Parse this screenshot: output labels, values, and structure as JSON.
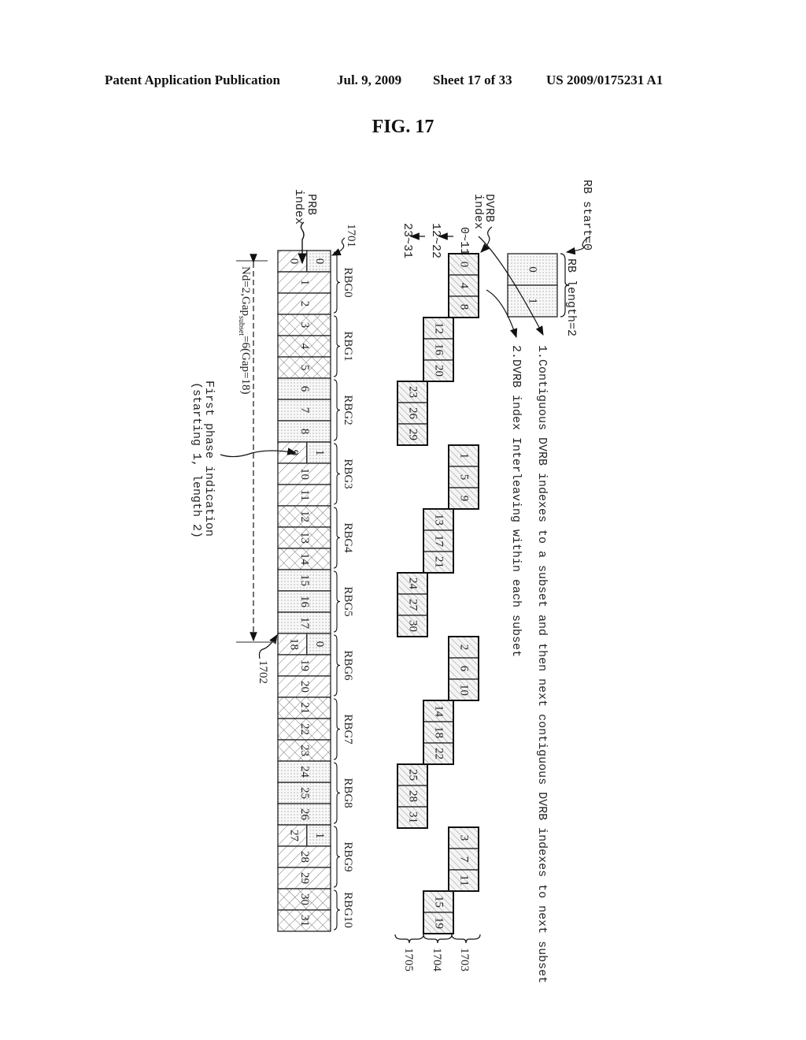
{
  "header": {
    "publication": "Patent Application Publication",
    "date": "Jul. 9, 2009",
    "sheet": "Sheet 17 of 33",
    "number": "US 2009/0175231 A1"
  },
  "figure_title": "FIG. 17",
  "labels": {
    "rb_start": "RB start=0",
    "rb_length": "RB length=2",
    "rb_cells": [
      "0",
      "1"
    ],
    "dvrb_index": [
      "DVRB",
      "index"
    ],
    "dvrb_ranges": [
      "0~11",
      "12~22",
      "23~31"
    ],
    "step1": "1.Contiguous DVRB indexes to a subset and then next contiguous DVRB indexes to next subset",
    "step2": "2.DVRB index Interleaving within each subset",
    "prb_index": [
      "PRB",
      "index"
    ],
    "ref_1701": "1701",
    "ref_1702": "1702",
    "gap_label_main": "Nd=2,Gap",
    "gap_label_sub": "subset",
    "gap_label_tail": "=6(Gap=18)",
    "first_phase": [
      "First phase indication",
      "(starting 1, length 2)"
    ],
    "subset_refs": [
      "1703",
      "1704",
      "1705"
    ]
  },
  "prb": {
    "cells": [
      "0",
      "1",
      "2",
      "3",
      "4",
      "5",
      "6",
      "7",
      "8",
      "9",
      "10",
      "11",
      "12",
      "13",
      "14",
      "15",
      "16",
      "17",
      "18",
      "19",
      "20",
      "21",
      "22",
      "23",
      "24",
      "25",
      "26",
      "27",
      "28",
      "29",
      "30",
      "31"
    ],
    "split_cells": {
      "0": "0",
      "9": "1",
      "18": "0",
      "27": "1"
    },
    "rbg_labels": [
      "RBG0",
      "RBG1",
      "RBG2",
      "RBG3",
      "RBG4",
      "RBG5",
      "RBG6",
      "RBG7",
      "RBG8",
      "RBG9",
      "RBG10"
    ],
    "rbg_pattern": [
      "hatch",
      "cross",
      "dots",
      "hatch",
      "cross",
      "dots",
      "hatch",
      "cross",
      "dots",
      "hatch",
      "cross"
    ]
  },
  "dvrb_subsets": [
    {
      "ref": "1703-1705",
      "groups": [
        [
          "0",
          "4",
          "8"
        ],
        [
          "12",
          "16",
          "20"
        ],
        [
          "23",
          "26",
          "29"
        ]
      ]
    },
    {
      "groups": [
        [
          "1",
          "5",
          "9"
        ],
        [
          "13",
          "17",
          "21"
        ],
        [
          "24",
          "27",
          "30"
        ]
      ]
    },
    {
      "groups": [
        [
          "2",
          "6",
          "10"
        ],
        [
          "14",
          "18",
          "22"
        ],
        [
          "25",
          "28",
          "31"
        ]
      ]
    },
    {
      "groups": [
        [
          "3",
          "7",
          "11"
        ],
        [
          "15",
          "19"
        ]
      ]
    }
  ]
}
